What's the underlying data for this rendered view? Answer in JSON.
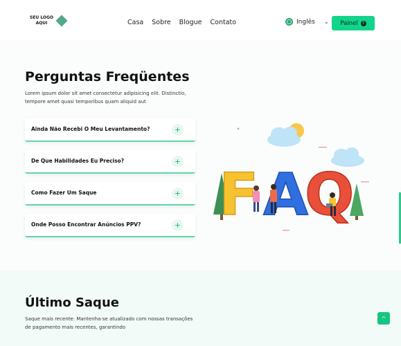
{
  "header": {
    "logo_line1": "SEU LOGO",
    "logo_line2": "AQUI",
    "nav": [
      "Casa",
      "Sobre",
      "Blogue",
      "Contato"
    ],
    "language": "Inglês",
    "language_icon": "globe-icon",
    "language_chevron": "chevron-down-icon",
    "panel_button": "Painel",
    "panel_icon": "question-circle-icon"
  },
  "faq": {
    "title": "Perguntas Freqüentes",
    "description": "Lorem ipsum dolor sit amet consectetur adipisicing elit. Distinctio, tempore amet quasi temporibus quam aliquid aut",
    "items": [
      {
        "question": "Ainda Não Recebi O Meu Levantamento?",
        "icon": "plus-icon"
      },
      {
        "question": "De Que Habilidades Eu Preciso?",
        "icon": "plus-icon"
      },
      {
        "question": "Como Fazer Um Saque",
        "icon": "plus-icon"
      },
      {
        "question": "Onde Posso Encontrar Anúncios PPV?",
        "icon": "plus-icon"
      }
    ],
    "illustration_text": "FAQ",
    "colors": {
      "accent": "#12d48a",
      "letter_f": "#f5c330",
      "letter_a": "#2f6fe0",
      "letter_q": "#e8503a"
    }
  },
  "withdraw": {
    "title": "Último Saque",
    "description": "Saque mais recente: Mantenha-se atualizado com nossas transações de pagamento mais recentes, garantindo"
  },
  "scroll_top_icon": "arrow-up-icon"
}
